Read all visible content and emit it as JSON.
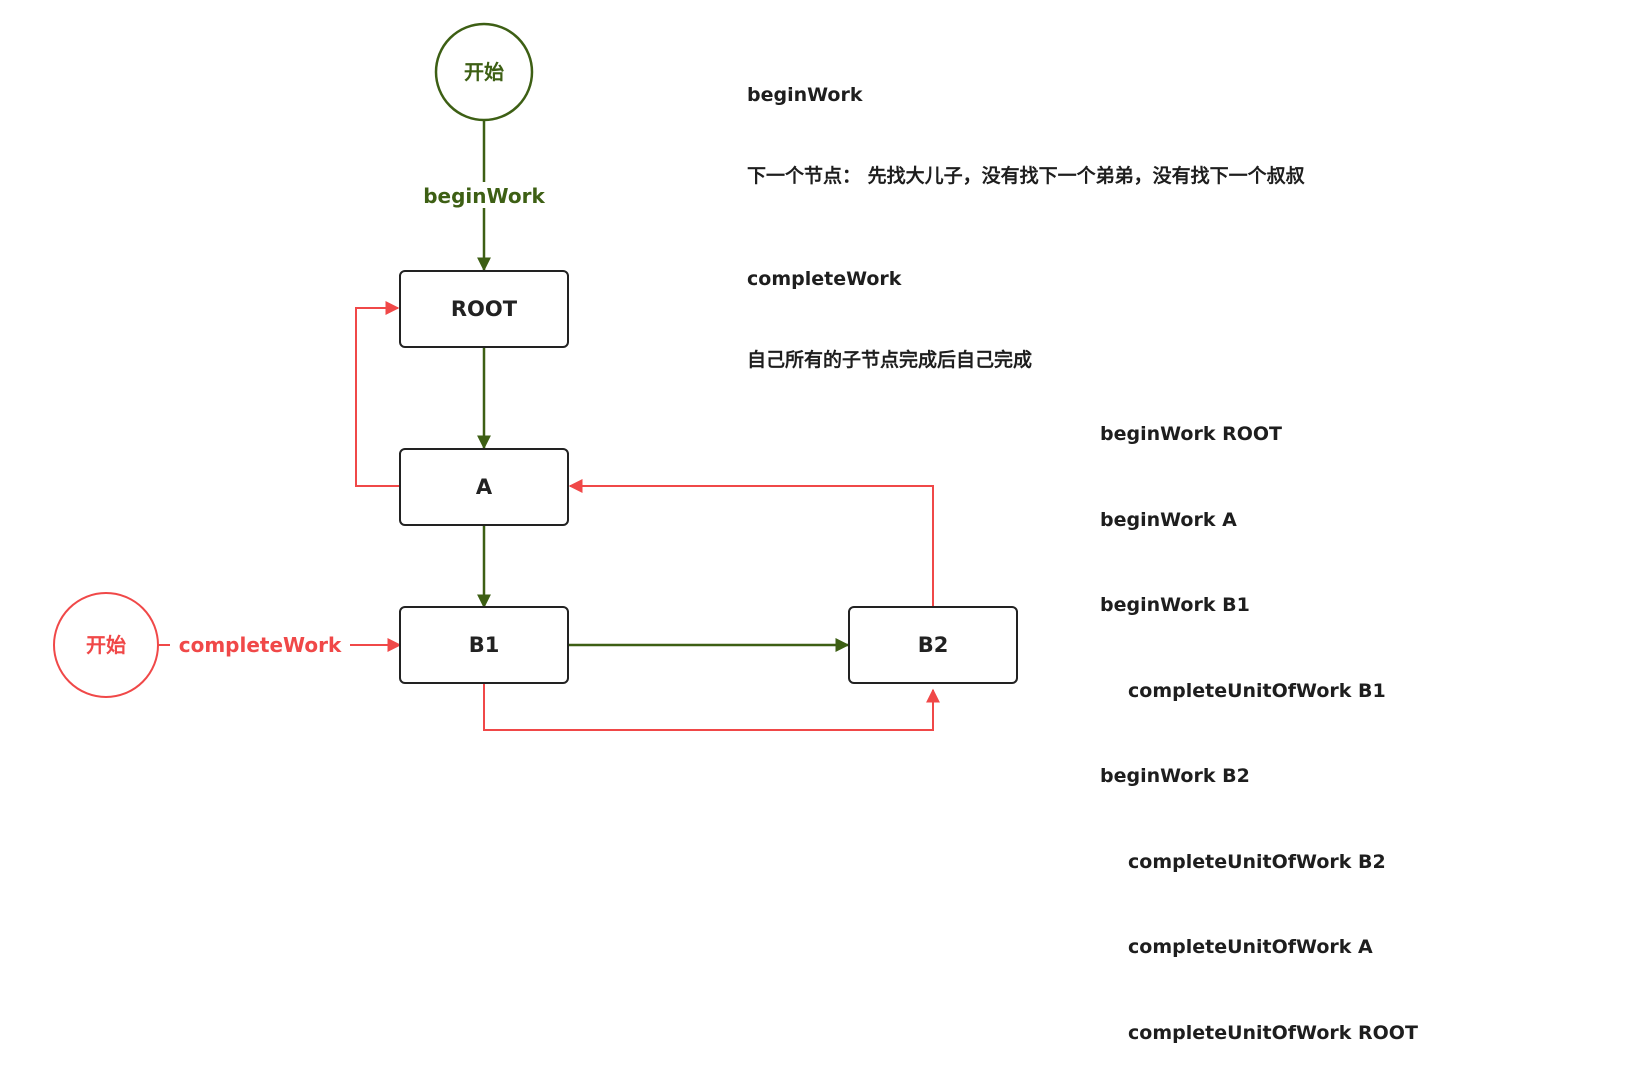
{
  "colors": {
    "begin": "#3d5f14",
    "complete": "#f04848",
    "node_border": "#222222",
    "text": "#1e1e1e"
  },
  "start_begin": {
    "label": "开始"
  },
  "start_complete": {
    "label": "开始"
  },
  "edge_labels": {
    "begin": "beginWork",
    "complete": "completeWork"
  },
  "nodes": {
    "root": "ROOT",
    "a": "A",
    "b1": "B1",
    "b2": "B2"
  },
  "notes": {
    "begin_title": "beginWork",
    "begin_desc": "下一个节点： 先找大儿子，没有找下一个弟弟，没有找下一个叔叔",
    "complete_title": "completeWork",
    "complete_desc": "自己所有的子节点完成后自己完成"
  },
  "trace": [
    {
      "text": "beginWork ROOT",
      "indent": false
    },
    {
      "text": "beginWork A",
      "indent": false
    },
    {
      "text": "beginWork B1",
      "indent": false
    },
    {
      "text": "completeUnitOfWork B1",
      "indent": true
    },
    {
      "text": "beginWork B2",
      "indent": false
    },
    {
      "text": "completeUnitOfWork B2",
      "indent": true
    },
    {
      "text": "completeUnitOfWork A",
      "indent": true
    },
    {
      "text": "completeUnitOfWork ROOT",
      "indent": true
    }
  ]
}
